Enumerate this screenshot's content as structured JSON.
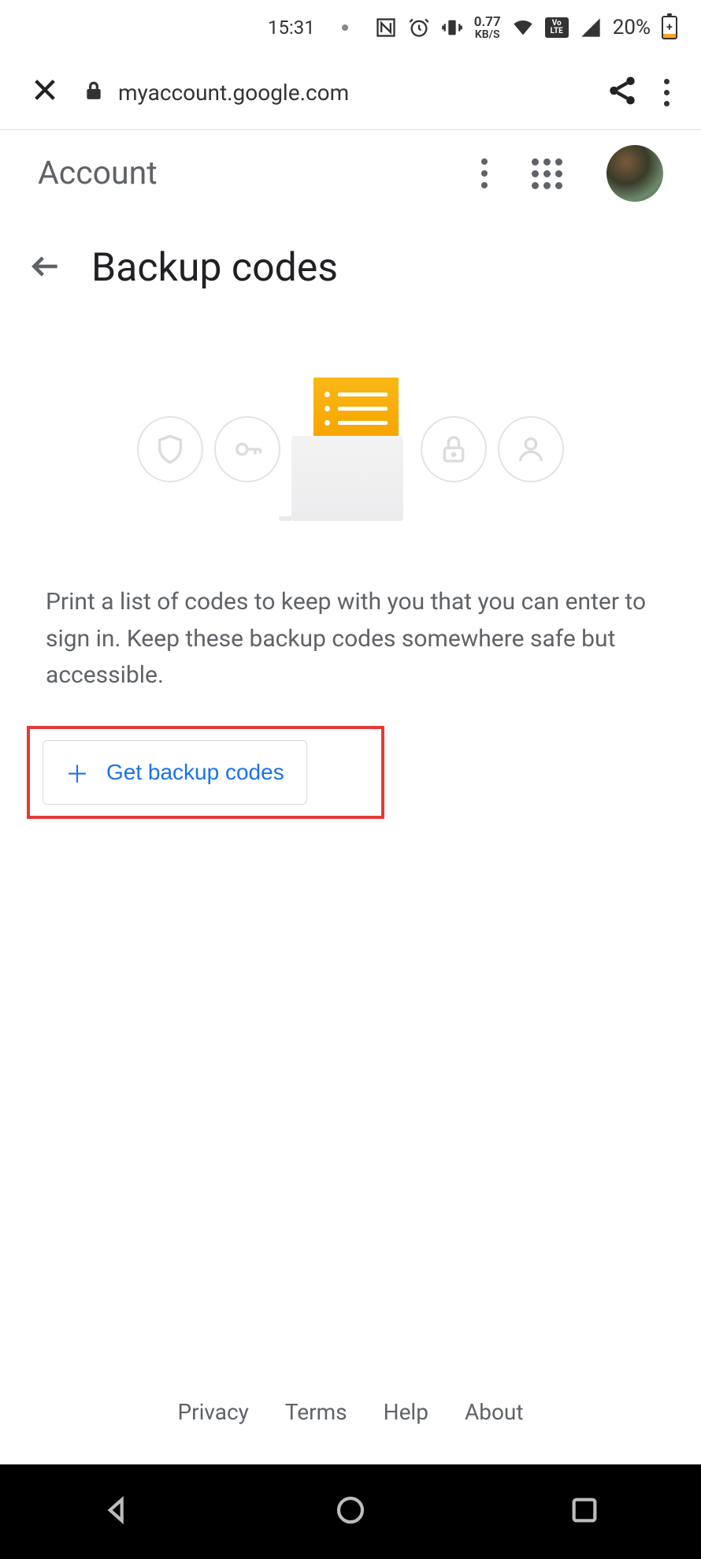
{
  "status_bar": {
    "time": "15:31",
    "data_rate_value": "0.77",
    "data_rate_unit": "KB/S",
    "lte_top": "Vo",
    "lte_bottom": "LTE",
    "battery_percent": "20%"
  },
  "browser": {
    "url": "myaccount.google.com"
  },
  "app_header": {
    "title": "Account"
  },
  "page": {
    "heading": "Backup codes",
    "description": "Print a list of codes to keep with you that you can enter to sign in. Keep these backup codes some­where safe but accessible.",
    "get_button_label": "Get backup codes"
  },
  "footer": {
    "privacy": "Privacy",
    "terms": "Terms",
    "help": "Help",
    "about": "About"
  },
  "colors": {
    "accent_blue": "#1a73e8",
    "highlight_red": "#e53935",
    "illustration_yellow": "#f7a400"
  }
}
